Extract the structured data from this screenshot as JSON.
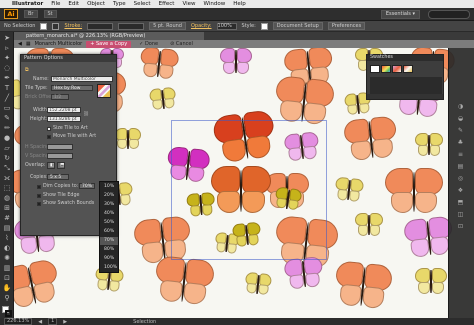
{
  "menubar": {
    "apple": "",
    "items": [
      "Illustrator",
      "File",
      "Edit",
      "Object",
      "Type",
      "Select",
      "Effect",
      "View",
      "Window",
      "Help"
    ]
  },
  "appbar": {
    "logo": "Ai",
    "buttons": [
      "Br",
      "St"
    ],
    "workspace": "Essentials ▾",
    "search_placeholder": ""
  },
  "controlbar": {
    "selection_label": "No Selection",
    "stroke_label": "Stroke:",
    "stroke_style": "5 pt. Round",
    "opacity_label": "Opacity:",
    "opacity_value": "100%",
    "style_label": "Style:",
    "document_setup": "Document Setup",
    "preferences": "Preferences"
  },
  "document": {
    "tab_title": "pattern_monarch.ai* @ 226.13% (RGB/Preview)"
  },
  "isolation": {
    "pattern_name": "Monarch Multicolor",
    "save_copy": "+ Save a Copy",
    "done": "✓ Done",
    "cancel": "⊘ Cancel"
  },
  "pattern_options": {
    "title": "Pattern Options",
    "name_label": "Name:",
    "name_value": "Monarch Multicolor",
    "tile_type_label": "Tile Type:",
    "tile_type_value": "Hex by Row",
    "brick_offset_label": "Brick Offset:",
    "brick_offset_value": "1/2",
    "width_label": "Width:",
    "width_value": "152.2208 pt",
    "height_label": "Height:",
    "height_value": "131.8286 pt",
    "size_tile_to_art": "Size Tile to Art",
    "move_tile_with_art": "Move Tile with Art",
    "h_spacing_label": "H Spacing:",
    "v_spacing_label": "V Spacing:",
    "overlap_label": "Overlap:",
    "copies_label": "Copies:",
    "copies_value": "5 x 5",
    "dim_copies_label": "Dim Copies to:",
    "dim_copies_value": "70%",
    "show_tile_edge": "Show Tile Edge",
    "show_swatch_bounds": "Show Swatch Bounds"
  },
  "dim_options": [
    "10%",
    "20%",
    "30%",
    "40%",
    "50%",
    "60%",
    "70%",
    "80%",
    "90%",
    "100%"
  ],
  "dim_selected": "70%",
  "swatches": {
    "title": "Swatches"
  },
  "status": {
    "zoom": "226.13%",
    "page": "1",
    "tool": "Selection"
  },
  "colors": {
    "accent": "#c84e70",
    "ai_orange": "#ff9a00",
    "canvas": "#f7f7f2"
  },
  "icons": {
    "toolbar": [
      "selection-tool-icon",
      "direct-selection-tool-icon",
      "magic-wand-icon",
      "lasso-icon",
      "pen-tool-icon",
      "type-tool-icon",
      "line-tool-icon",
      "rectangle-tool-icon",
      "paintbrush-icon",
      "pencil-icon",
      "blob-brush-icon",
      "eraser-icon",
      "rotate-icon",
      "scale-icon",
      "width-tool-icon",
      "free-transform-icon",
      "shape-builder-icon",
      "perspective-grid-icon",
      "mesh-icon",
      "gradient-icon",
      "eyedropper-icon",
      "blend-icon",
      "symbol-sprayer-icon",
      "graph-icon",
      "artboard-icon",
      "slice-icon",
      "hand-icon",
      "zoom-icon"
    ],
    "right_strip": [
      "color-panel-icon",
      "color-guide-icon",
      "swatches-icon",
      "brushes-icon",
      "symbols-icon",
      "stroke-icon",
      "gradient-panel-icon",
      "transparency-icon",
      "appearance-icon",
      "graphic-styles-icon",
      "layers-icon",
      "artboards-icon"
    ]
  }
}
